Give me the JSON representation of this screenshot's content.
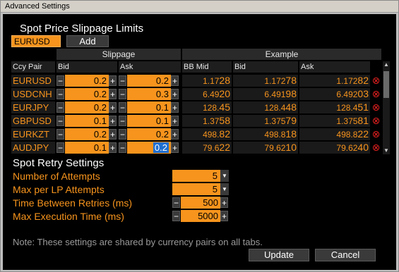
{
  "window": {
    "title": "Advanced Settings"
  },
  "spot": {
    "title": "Spot Price Slippage Limits",
    "selected_ccy": "EURUSD",
    "add_label": "Add"
  },
  "grid": {
    "group_headers": {
      "slippage": "Slippage",
      "example": "Example"
    },
    "columns": {
      "pair": "Ccy Pair",
      "bid": "Bid",
      "ask": "Ask",
      "bb_mid": "BB Mid",
      "ex_bid": "Bid",
      "ex_ask": "Ask"
    },
    "rows": [
      {
        "pair": "EURUSD",
        "bid": "0.2",
        "ask": "0.2",
        "mid_a": "1.17",
        "mid_b": "28",
        "eb_a": "1.172",
        "eb_b": "78",
        "ea_a": "1.172",
        "ea_b": "82",
        "ask_selected": false
      },
      {
        "pair": "USDCNH",
        "bid": "0.2",
        "ask": "0.3",
        "mid_a": "6.49",
        "mid_b": "20",
        "eb_a": "6.491",
        "eb_b": "98",
        "ea_a": "6.492",
        "ea_b": "03",
        "ask_selected": false
      },
      {
        "pair": "EURJPY",
        "bid": "0.2",
        "ask": "0.1",
        "mid_a": "128.",
        "mid_b": "45",
        "eb_a": "128.4",
        "eb_b": "48",
        "ea_a": "128.4",
        "ea_b": "51",
        "ask_selected": false
      },
      {
        "pair": "GBPUSD",
        "bid": "0.1",
        "ask": "0.1",
        "mid_a": "1.37",
        "mid_b": "58",
        "eb_a": "1.375",
        "eb_b": "79",
        "ea_a": "1.375",
        "ea_b": "81",
        "ask_selected": false
      },
      {
        "pair": "EURKZT",
        "bid": "0.2",
        "ask": "0.2",
        "mid_a": "498.",
        "mid_b": "82",
        "eb_a": "498.8",
        "eb_b": "18",
        "ea_a": "498.8",
        "ea_b": "22",
        "ask_selected": false
      },
      {
        "pair": "AUDJPY",
        "bid": "0.1",
        "ask": "0.2",
        "mid_a": "79.6",
        "mid_b": "22",
        "eb_a": "79.62",
        "eb_b": "10",
        "ea_a": "79.62",
        "ea_b": "40",
        "ask_selected": true
      }
    ],
    "minus": "−",
    "plus": "+",
    "delete_glyph": "⊗"
  },
  "retry": {
    "title": "Spot Retry Settings",
    "attempts_label": "Number of Attempts",
    "attempts_value": "5",
    "max_lp_label": "Max per LP Attempts",
    "max_lp_value": "5",
    "between_label": "Time Between Retries (ms)",
    "between_value": "500",
    "max_exec_label": "Max Execution Time (ms)",
    "max_exec_value": "5000"
  },
  "note": "Note: These settings are shared by currency pairs on all tabs.",
  "buttons": {
    "update": "Update",
    "cancel": "Cancel"
  },
  "colors": {
    "accent": "#f7941d",
    "panel": "#000000",
    "delete": "#e02020"
  }
}
